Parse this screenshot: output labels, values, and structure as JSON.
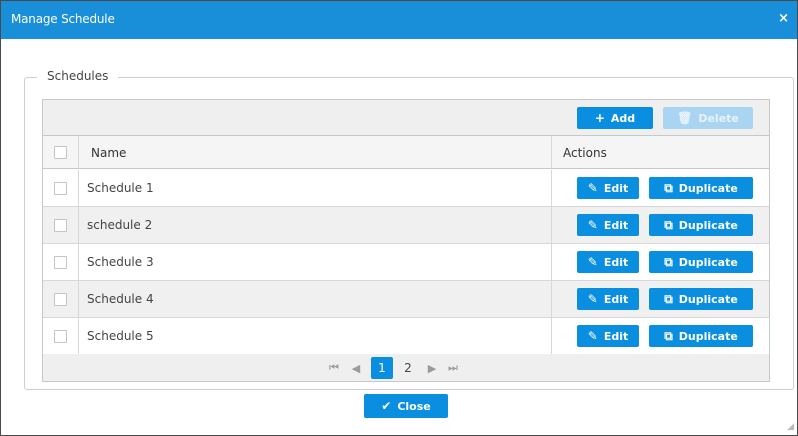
{
  "dialog": {
    "title": "Manage Schedule",
    "close_icon": "×"
  },
  "section": {
    "legend": "Schedules"
  },
  "toolbar": {
    "add_label": "Add",
    "add_icon": "+",
    "delete_label": "Delete",
    "delete_icon": "🗑"
  },
  "table": {
    "headers": {
      "name": "Name",
      "actions": "Actions"
    },
    "rows": [
      {
        "name": "Schedule 1"
      },
      {
        "name": "schedule 2"
      },
      {
        "name": "Schedule 3"
      },
      {
        "name": "Schedule 4"
      },
      {
        "name": "Schedule 5"
      }
    ],
    "edit_label": "Edit",
    "duplicate_label": "Duplicate",
    "edit_icon": "✎",
    "duplicate_icon": "⧉"
  },
  "pager": {
    "first": "⏮",
    "prev": "◀",
    "pages": [
      "1",
      "2"
    ],
    "current": "1",
    "next": "▶",
    "last": "⏭"
  },
  "footer": {
    "close_label": "Close",
    "close_icon": "✔"
  },
  "colors": {
    "accent": "#0a8ee0",
    "titlebar": "#1a8fd9"
  }
}
